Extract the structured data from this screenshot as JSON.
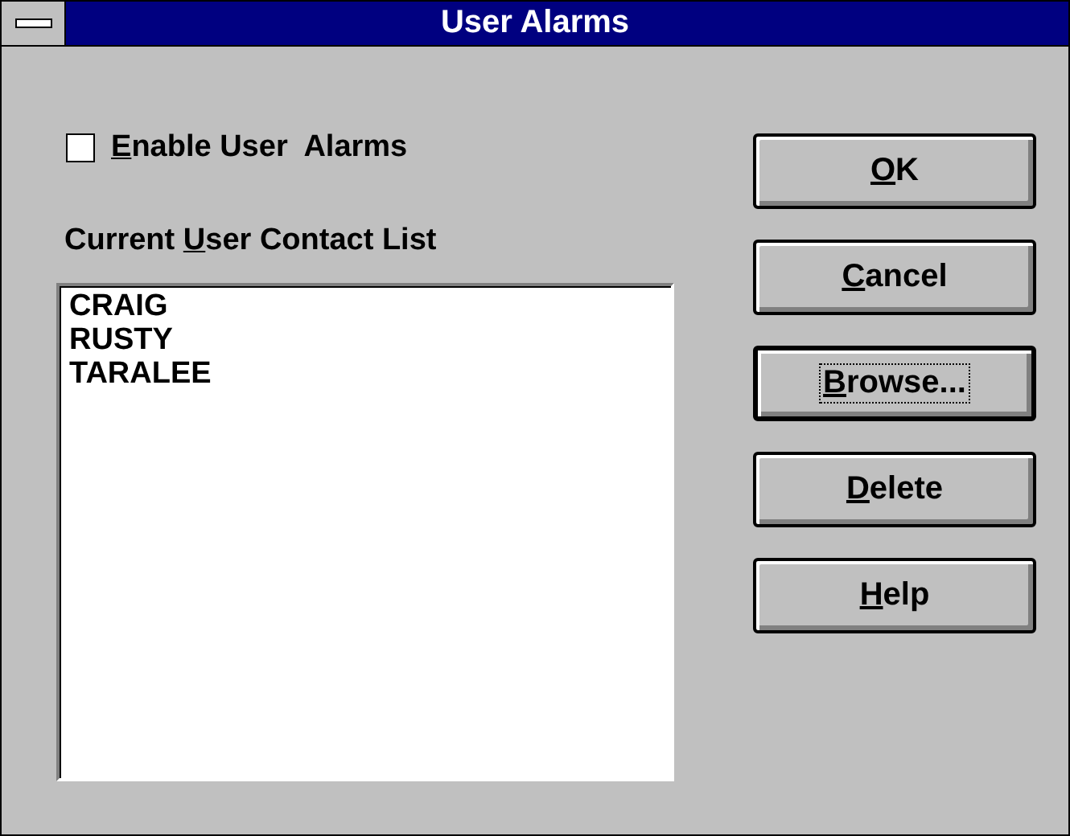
{
  "window": {
    "title": "User Alarms"
  },
  "enable_checkbox": {
    "label": {
      "key": "E",
      "after": "nable User  Alarms"
    },
    "checked": false
  },
  "list_label": {
    "before": "Current ",
    "key": "U",
    "after": "ser Contact List"
  },
  "contacts": [
    {
      "name": "CRAIG",
      "selected": false
    },
    {
      "name": "RUSTY",
      "selected": false
    },
    {
      "name": "TARALEE",
      "selected": false
    }
  ],
  "buttons": [
    {
      "label": {
        "key": "O",
        "after": "K"
      },
      "focused": false
    },
    {
      "label": {
        "key": "C",
        "after": "ancel"
      },
      "focused": false
    },
    {
      "label": {
        "key": "B",
        "after": "rowse..."
      },
      "focused": true
    },
    {
      "label": {
        "key": "D",
        "after": "elete"
      },
      "focused": false
    },
    {
      "label": {
        "key": "H",
        "after": "elp"
      },
      "focused": false
    }
  ]
}
